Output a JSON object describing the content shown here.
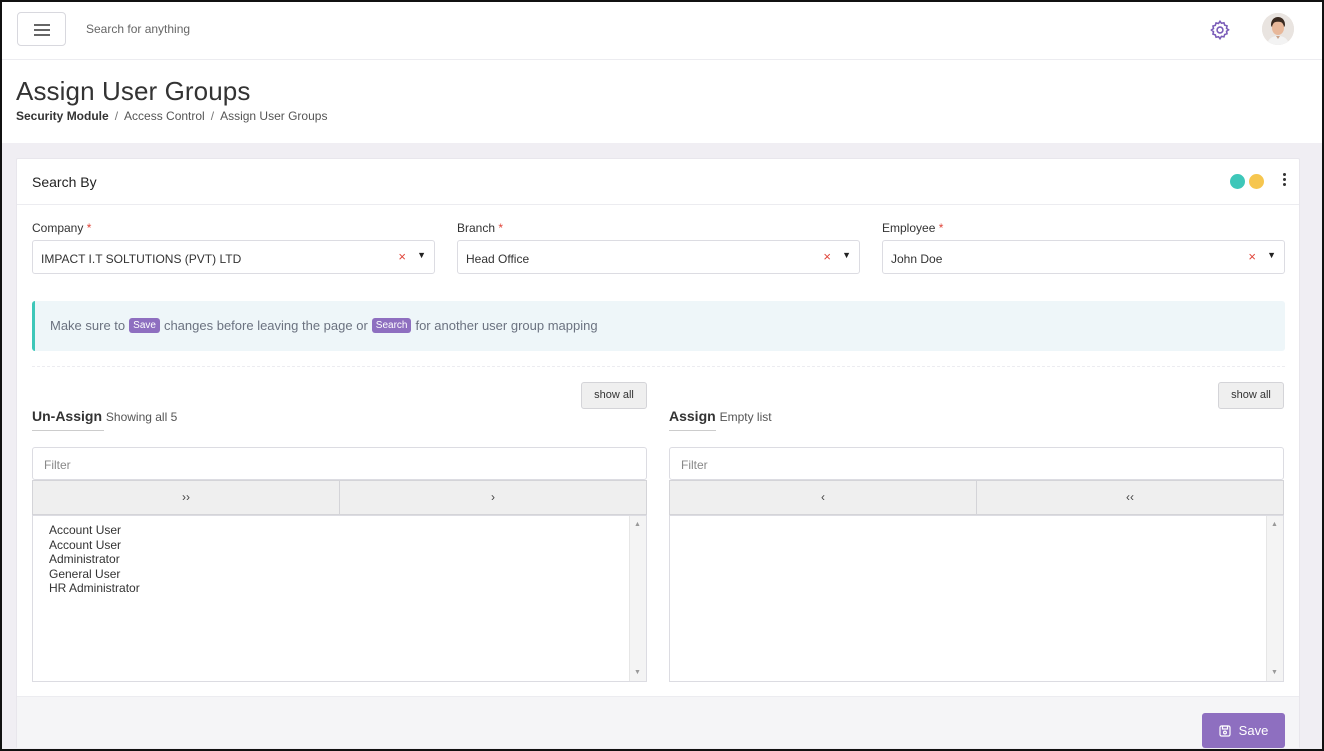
{
  "topbar": {
    "search_text": "Search for anything"
  },
  "header": {
    "title": "Assign User Groups",
    "breadcrumb": [
      "Security Module",
      "Access Control",
      "Assign User Groups"
    ],
    "separator": "/"
  },
  "card": {
    "title": "Search By",
    "company": {
      "label": "Company",
      "required": "*",
      "value": "IMPACT I.T SOLTUTIONS (PVT) LTD"
    },
    "branch": {
      "label": "Branch",
      "required": "*",
      "value": "Head Office"
    },
    "employee": {
      "label": "Employee",
      "required": "*",
      "value": "John Doe"
    },
    "clear_glyph": "×",
    "caret_glyph": "▼",
    "notice": {
      "part1": "Make sure to",
      "save_pill": "Save",
      "part2": "changes before leaving the page or",
      "search_pill": "Search",
      "part3": "for another user group mapping"
    },
    "unassign": {
      "title": "Un-Assign",
      "subtitle": "Showing all 5",
      "show_all": "show all",
      "filter_placeholder": "Filter",
      "move_all": "››",
      "move_selected": "›",
      "items": [
        "Account User",
        "Account User",
        "Administrator",
        "General User",
        "HR Administrator"
      ]
    },
    "assign": {
      "title": "Assign",
      "subtitle": "Empty list",
      "show_all": "show all",
      "filter_placeholder": "Filter",
      "remove_selected": "‹",
      "remove_all": "‹‹",
      "items": []
    },
    "save_label": "Save"
  },
  "colors": {
    "accent": "#8e6fc0",
    "teal": "#3ec7b9",
    "yellow": "#f6c64f",
    "required": "#e0453a"
  },
  "icons": {
    "menu": "hamburger-icon",
    "settings": "gear-icon",
    "avatar": "user-avatar",
    "more": "kebab-icon",
    "save": "floppy-icon"
  }
}
